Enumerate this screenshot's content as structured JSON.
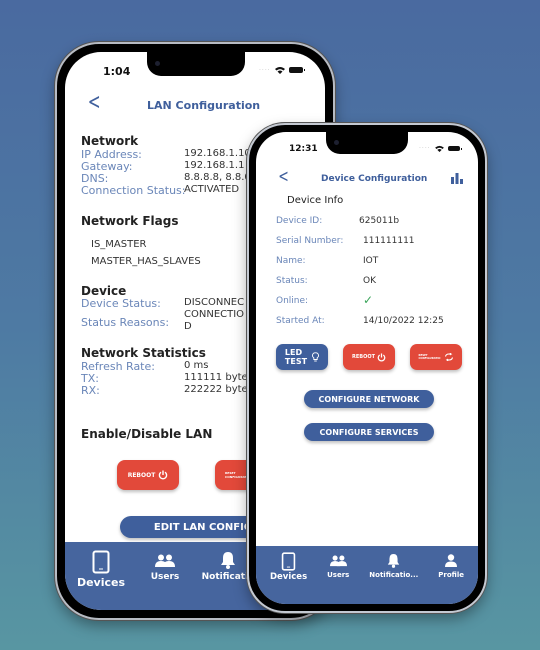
{
  "lan_phone": {
    "status_time": "1:04",
    "header": {
      "back_icon": "chevron-left-icon",
      "title": "LAN Configuration"
    },
    "network": {
      "title": "Network",
      "rows": [
        {
          "label": "IP Address:",
          "value": "192.168.1.100/2"
        },
        {
          "label": "Gateway:",
          "value": "192.168.1.1"
        },
        {
          "label": "DNS:",
          "value": "8.8.8.8, 8.8.0."
        },
        {
          "label": "Connection Status:",
          "value": "ACTIVATED"
        }
      ]
    },
    "network_flags": {
      "title": "Network Flags",
      "items": [
        "IS_MASTER",
        "MASTER_HAS_SLAVES"
      ]
    },
    "device": {
      "title": "Device",
      "rows": [
        {
          "label": "Device Status:",
          "value": "DISCONNEC"
        },
        {
          "label": "Status Reasons:",
          "value": "CONNECTIO",
          "value2": "D"
        }
      ]
    },
    "network_statistics": {
      "title": "Network Statistics",
      "rows": [
        {
          "label": "Refresh Rate:",
          "value": "0 ms"
        },
        {
          "label": "TX:",
          "value": "111111 bytes"
        },
        {
          "label": "RX:",
          "value": "222222 bytes"
        }
      ]
    },
    "enable_disable": {
      "title": "Enable/Disable LAN"
    },
    "buttons": {
      "reboot": "REBOOT",
      "reset": "RESET CONFIGURATION",
      "edit": "EDIT LAN CONFIG"
    },
    "nav": [
      {
        "label": "Devices",
        "icon": "tablet-icon"
      },
      {
        "label": "Users",
        "icon": "users-icon"
      },
      {
        "label": "Notificatio",
        "icon": "bell-icon"
      }
    ]
  },
  "device_phone": {
    "status_time": "12:31",
    "header": {
      "back_icon": "chevron-left-icon",
      "title": "Device Configuration",
      "action_icon": "bar-chart-icon"
    },
    "section_title": "Device Info",
    "rows": [
      {
        "label": "Device ID:",
        "value": "625011b"
      },
      {
        "label": "Serial Number:",
        "value": "111111111"
      },
      {
        "label": "Name:",
        "value": "IOT"
      },
      {
        "label": "Status:",
        "value": "OK"
      },
      {
        "label": "Online:",
        "value": "✓"
      },
      {
        "label": "Started At:",
        "value": "14/10/2022 12:25"
      }
    ],
    "buttons": {
      "led_test_line1": "LED",
      "led_test_line2": "TEST",
      "reboot": "REBOOT",
      "reset_line1": "RESET",
      "reset_line2": "CONFIGURATIO",
      "configure_network": "CONFIGURE NETWORK",
      "configure_services": "CONFIGURE SERVICES"
    },
    "nav": [
      {
        "label": "Devices",
        "icon": "tablet-icon"
      },
      {
        "label": "Users",
        "icon": "users-icon"
      },
      {
        "label": "Notificatio...",
        "icon": "bell-icon"
      },
      {
        "label": "Profile",
        "icon": "person-icon"
      }
    ]
  },
  "colors": {
    "brand_blue": "#3f5f9c",
    "nav_blue": "#46659e",
    "danger_red": "#e2493a",
    "label_blue": "#6a86b8",
    "online_green": "#3aa55a"
  }
}
